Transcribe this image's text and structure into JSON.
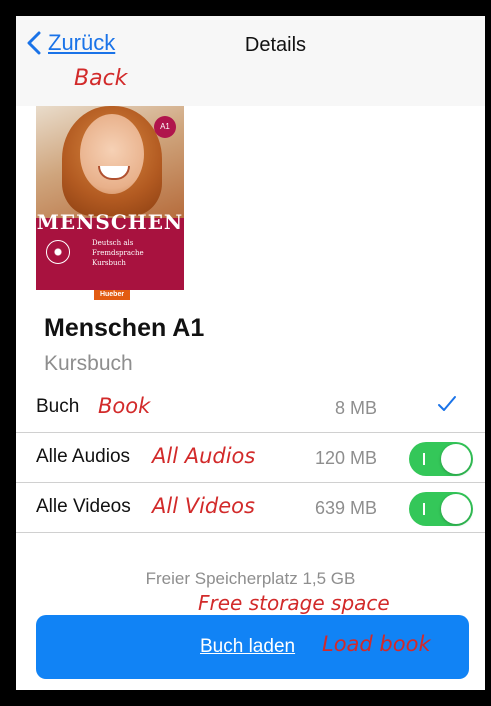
{
  "navbar": {
    "back_label": "Zurück",
    "back_annotation": "Back",
    "title": "Details",
    "icons": {
      "back": "chevron-left-icon"
    }
  },
  "book": {
    "cover": {
      "title": "MENSCHEN",
      "subtitle_line1": "Deutsch als Fremdsprache",
      "subtitle_line2": "Kursbuch",
      "level": "A1",
      "publisher": "Hueber"
    },
    "title": "Menschen A1",
    "subtitle": "Kursbuch"
  },
  "downloads": {
    "rows": [
      {
        "label": "Buch",
        "annotation": "Book",
        "size": "8 MB",
        "control": "checkmark",
        "selected": true
      },
      {
        "label": "Alle Audios",
        "annotation": "All Audios",
        "size": "120 MB",
        "control": "toggle",
        "enabled": true
      },
      {
        "label": "Alle Videos",
        "annotation": "All Videos",
        "size": "639 MB",
        "control": "toggle",
        "enabled": true
      }
    ]
  },
  "storage": {
    "text": "Freier Speicherplatz 1,5 GB",
    "annotation": "Free storage space"
  },
  "action": {
    "load_label": "Buch laden",
    "load_annotation": "Load book"
  },
  "colors": {
    "accent": "#1a73e8",
    "button": "#1183f5",
    "toggle_on": "#34c759",
    "annotation": "#d22a2a",
    "secondary_text": "#8e8e8e"
  }
}
